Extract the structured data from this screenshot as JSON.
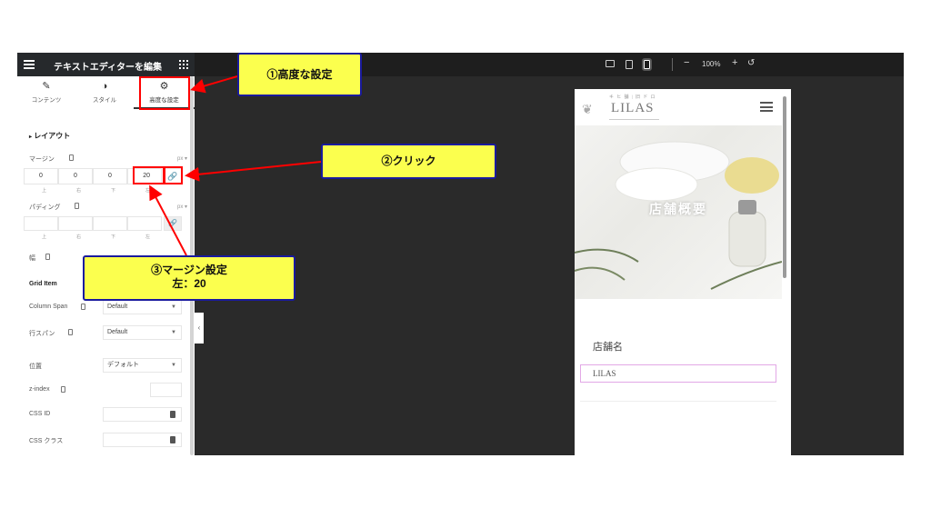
{
  "panel": {
    "title": "テキストエディターを編集",
    "tabs": [
      {
        "label": "コンテンツ",
        "icon": "pencil-icon"
      },
      {
        "label": "スタイル",
        "icon": "half-circle-icon"
      },
      {
        "label": "高度な設定",
        "icon": "gear-icon"
      }
    ],
    "layout_section": "レイアウト",
    "margin": {
      "label": "マージン",
      "unit": "px",
      "values": [
        "0",
        "0",
        "0",
        "20"
      ],
      "sides": [
        "上",
        "右",
        "下",
        "左"
      ]
    },
    "padding": {
      "label": "パディング",
      "unit": "px",
      "sides": [
        "上",
        "右",
        "下",
        "左"
      ]
    },
    "width_label": "幅",
    "grid_item_section": "Grid Item",
    "column_span": {
      "label": "Column Span",
      "value": "Default"
    },
    "row_span": {
      "label": "行スパン",
      "value": "Default"
    },
    "position": {
      "label": "位置",
      "value": "デフォルト"
    },
    "z_index_label": "z-index",
    "css_id_label": "CSS ID",
    "css_class_label": "CSS クラス"
  },
  "topbar": {
    "zoom": "100%"
  },
  "phone": {
    "logo_sub": "キ ヒ 舗 | 旧 ド ロ",
    "logo_text": "LILAS",
    "hero_title": "店舗概要",
    "store_heading": "店舗名",
    "store_value": "LILAS"
  },
  "callouts": {
    "step1": "①高度な設定",
    "step2": "②クリック",
    "step3_line1": "③マージン設定",
    "step3_line2": "左：20"
  },
  "colors": {
    "callout_fill": "#fbff4e",
    "callout_border": "#1a1a9e",
    "highlight": "#ff0000",
    "dark_ui": "#26292c",
    "canvas": "#2a2a2a"
  }
}
